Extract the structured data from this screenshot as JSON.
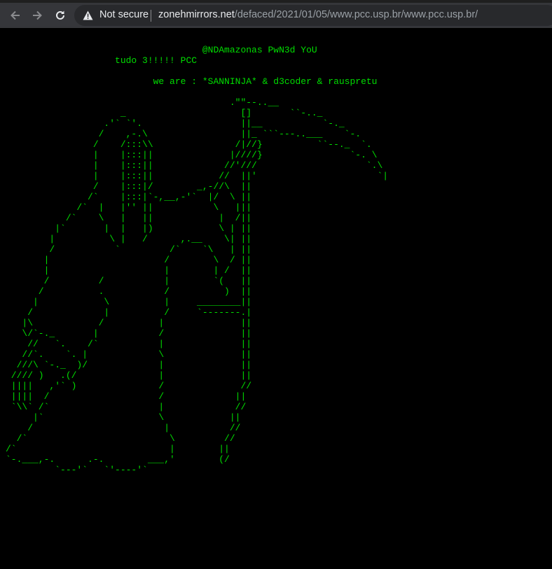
{
  "browser": {
    "security_label": "Not secure",
    "url_host": "zonehmirrors.net",
    "url_path": "/defaced/2021/01/05/www.pcc.usp.br/www.pcc.usp.br/",
    "icons": [
      "back-arrow-icon",
      "forward-arrow-icon",
      "reload-icon",
      "warning-icon"
    ]
  },
  "page": {
    "text_color": "#00dd00",
    "background": "#000000",
    "headline": "                                    @NDAmazonas PwN3d YoU",
    "subline": "                    tudo 3!!!!! PCC",
    "credits": "                           we are : *SANNINJA* & d3coder & rauspretu",
    "art": [
      "                                         .\"\"--..__",
      "                     _                     []       ``-.._",
      "                  .'` `'.                  ||__           `-._",
      "                 /    ,-.\\                 ||_ ```---..___    `-.",
      "                /    /:::\\\\               /|//}          ``--._  `.",
      "                |    |:::||              |////}                `-. \\",
      "                |    |:::||             //'///                    `.\\",
      "                |    |:::||            //  ||'                      `|",
      "                /    |:::|/        _,-//\\  ||",
      "               /`    |:::|`-,__,-'`  |/  \\ ||",
      "             /`  |   |'' ||           \\   |||",
      "           /`    \\   |   ||            |  /||",
      "         |`       |  |   |)            \\ | ||",
      "        |          \\ |   /      ,.__    \\| ||",
      "        /           `         /`    `\\   | ||",
      "       |                     /        \\  / ||",
      "       |                     |        | /  ||",
      "       /         /           |        `(   ||",
      "      /          .           /          )  ||",
      "     |            \\          |     ________||",
      "    /             |          /     `-------.|",
      "   |\\            /          |              ||",
      "   \\/`-._       |           /              ||",
      "    //   `.    /`           |              ||",
      "   //`.    `. |             \\              ||",
      "  ///\\ `-._  )/             |              ||",
      " //// )   .(/               |              ||",
      " ||||   ,'` )               /              //",
      " ||||  /                    /             ||",
      " `\\\\` /`                    |             //",
      "     |`                     \\            ||",
      "    /                        |           //",
      "  /`                          \\         //",
      "/`                            |        ||",
      "`-.___,-.      .-.        ___,'        (/",
      "         `---'`   `'----'`"
    ]
  }
}
